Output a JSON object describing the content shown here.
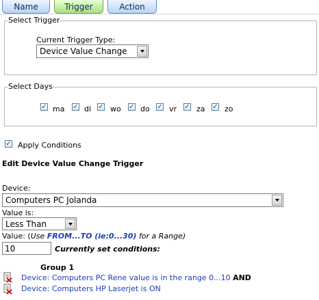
{
  "tabs": [
    {
      "label": "Name",
      "active": false
    },
    {
      "label": "Trigger",
      "active": true
    },
    {
      "label": "Action",
      "active": false
    }
  ],
  "select_trigger": {
    "legend": "Select Trigger",
    "type_label": "Current Trigger Type:",
    "type_value": "Device Value Change"
  },
  "select_days": {
    "legend": "Select Days",
    "days": [
      {
        "label": "ma",
        "checked": true
      },
      {
        "label": "di",
        "checked": true
      },
      {
        "label": "wo",
        "checked": true
      },
      {
        "label": "do",
        "checked": true
      },
      {
        "label": "vr",
        "checked": true
      },
      {
        "label": "za",
        "checked": true
      },
      {
        "label": "zo",
        "checked": true
      }
    ]
  },
  "apply_conditions": {
    "label": "Apply Conditions",
    "checked": true
  },
  "edit_heading": "Edit Device Value Change Trigger",
  "device": {
    "label": "Device:",
    "value": "Computers PC Jolanda"
  },
  "value_is": {
    "label": "Value is:",
    "value": "Less Than"
  },
  "value_hint": {
    "prefix": "Value: (",
    "use": "Use ",
    "range": "FROM...TO (ie:0...30)",
    "suffix": " for a Range)"
  },
  "value_input": "10",
  "current_conditions_label": "Currently set conditions:",
  "group": {
    "title": "Group 1",
    "conditions": [
      {
        "text": "Device: Computers PC Rene value is in the range 0...10",
        "joiner": "AND"
      },
      {
        "text": "Device: Computers HP Laserjet is ON",
        "joiner": ""
      }
    ]
  },
  "colors": {
    "tab_active": "#a6e07e",
    "tab_inactive": "#b9d4f6",
    "link": "#1a3fb4",
    "range_highlight": "#1a3fb4"
  }
}
